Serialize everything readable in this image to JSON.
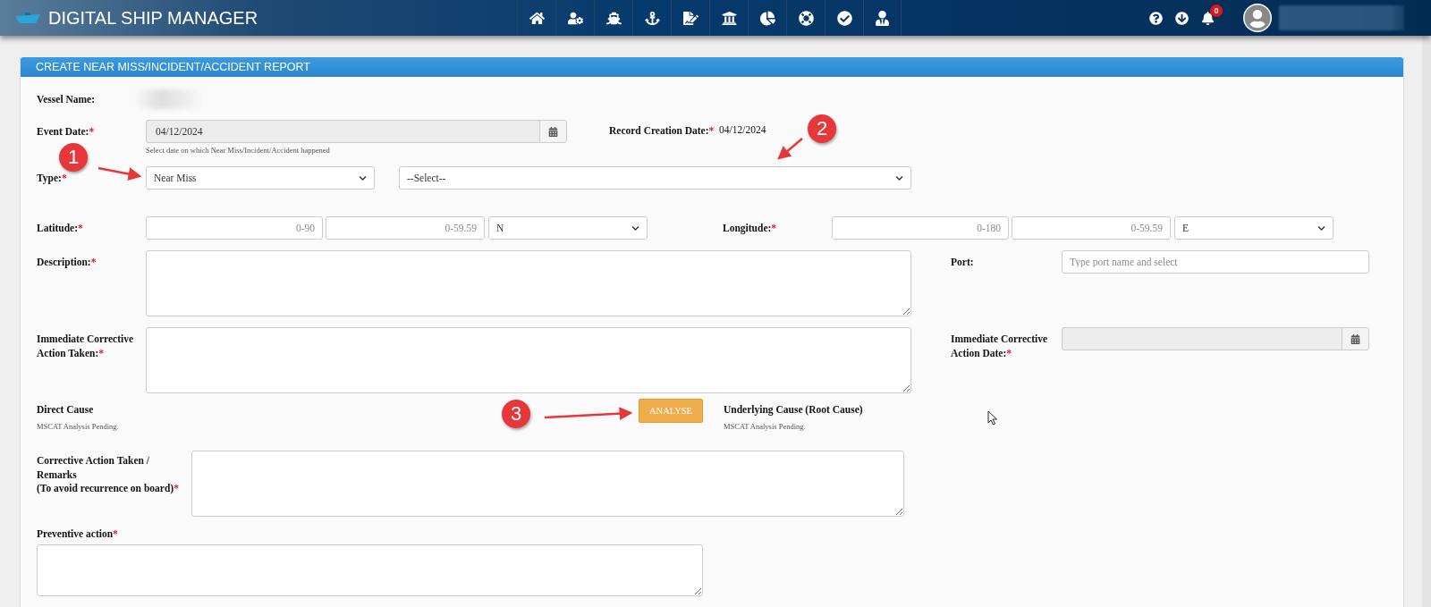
{
  "app": {
    "title": "DIGITAL SHIP MANAGER",
    "notification_count": "0"
  },
  "panel_title": "CREATE NEAR MISS/INCIDENT/ACCIDENT REPORT",
  "vessel_name": {
    "label": "Vessel Name:"
  },
  "event_date": {
    "label": "Event Date:",
    "required_mark": "*",
    "value": "04/12/2024",
    "hint": "Select date on which Near Miss/Incident/Accident happened"
  },
  "record_creation_date": {
    "label": "Record Creation Date:",
    "required_mark": "*",
    "value": "04/12/2024"
  },
  "type": {
    "label": "Type:",
    "required_mark": "*",
    "value": "Near Miss",
    "subtype_value": "--Select--"
  },
  "latitude": {
    "label": "Latitude:",
    "required_mark": "*",
    "degrees_placeholder": "0-90",
    "minutes_placeholder": "0-59.59",
    "hemisphere": "N"
  },
  "longitude": {
    "label": "Longitude:",
    "required_mark": "*",
    "degrees_placeholder": "0-180",
    "minutes_placeholder": "0-59.59",
    "hemisphere": "E"
  },
  "description": {
    "label": "Description:",
    "required_mark": "*"
  },
  "port": {
    "label": "Port:",
    "placeholder": "Type port name and select"
  },
  "immediate_action": {
    "label": "Immediate Corrective Action Taken:",
    "required_mark": "*"
  },
  "immediate_action_date": {
    "label": "Immediate Corrective Action Date:",
    "required_mark": "*"
  },
  "direct_cause": {
    "label": "Direct Cause",
    "status": "MSCAT Analysis Pending."
  },
  "analyse_button": "ANALYSE",
  "underlying_cause": {
    "label": "Underlying Cause (Root Cause)",
    "status": "MSCAT Analysis Pending."
  },
  "corrective_action": {
    "label": "Corrective Action Taken /\nRemarks\n(To avoid recurrence on board)",
    "required_mark": "*"
  },
  "preventive_action": {
    "label": "Preventive action",
    "required_mark": "*"
  },
  "annotations": [
    {
      "number": "1"
    },
    {
      "number": "2"
    },
    {
      "number": "3"
    }
  ]
}
